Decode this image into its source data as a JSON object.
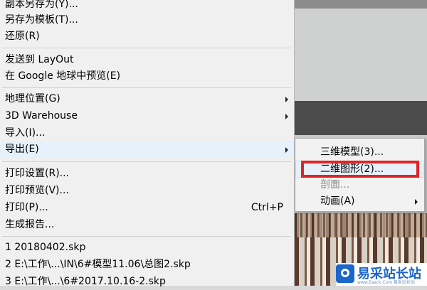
{
  "main_menu": {
    "items": [
      {
        "label": "副本另存为(Y)..."
      },
      {
        "label": "另存为模板(T)..."
      },
      {
        "label": "还原(R)"
      },
      {
        "label": "发送到 LayOut"
      },
      {
        "label": "在 Google 地球中预览(E)"
      },
      {
        "label": "地理位置(G)"
      },
      {
        "label": "3D Warehouse"
      },
      {
        "label": "导入(I)..."
      },
      {
        "label": "导出(E)"
      },
      {
        "label": "打印设置(R)..."
      },
      {
        "label": "打印预览(V)..."
      },
      {
        "label": "打印(P)...",
        "shortcut": "Ctrl+P"
      },
      {
        "label": "生成报告..."
      },
      {
        "label": "1 20180402.skp"
      },
      {
        "label": "2 E:\\工作\\...\\IN\\6#模型11.06\\总图2.skp"
      },
      {
        "label": "3 E:\\工作\\...\\6#2017.10.16-2.skp"
      }
    ]
  },
  "export_submenu": {
    "items": [
      {
        "label": "三维模型(3)..."
      },
      {
        "label": "二维图形(2)..."
      },
      {
        "label": "剖面..."
      },
      {
        "label": "动画(A)"
      }
    ]
  },
  "watermark": {
    "title": "易采站长站",
    "subtitle": "www.Easck.Com 易采站长站"
  },
  "colors": {
    "highlight_box": "#e02424",
    "menu_bg": "#f0f0f0",
    "watermark_brand": "#1b66c9"
  }
}
